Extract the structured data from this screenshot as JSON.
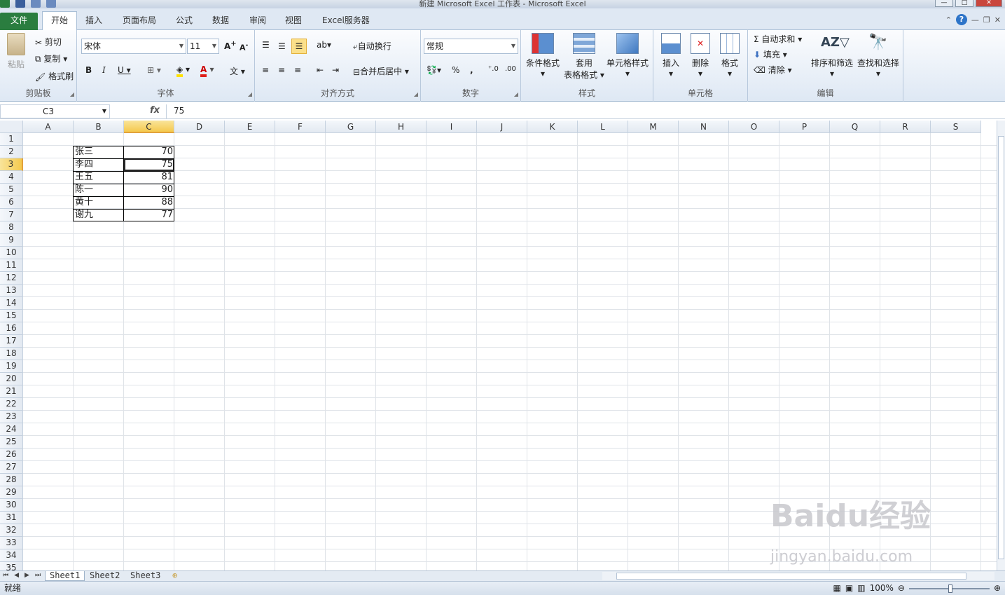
{
  "window": {
    "title": "新建 Microsoft Excel 工作表 - Microsoft Excel"
  },
  "tabs": {
    "file": "文件",
    "home": "开始",
    "insert": "插入",
    "layout": "页面布局",
    "formula": "公式",
    "data": "数据",
    "review": "审阅",
    "view": "视图",
    "server": "Excel服务器"
  },
  "clipboard": {
    "paste": "粘贴",
    "cut": "剪切",
    "copy": "复制",
    "format_painter": "格式刷",
    "label": "剪贴板"
  },
  "font": {
    "name": "宋体",
    "size": "11",
    "label": "字体"
  },
  "align": {
    "wrap": "自动换行",
    "merge": "合并后居中",
    "label": "对齐方式"
  },
  "number": {
    "format": "常规",
    "label": "数字"
  },
  "styles": {
    "cond": "条件格式",
    "table_1": "套用",
    "table_2": "表格格式",
    "cell": "单元格样式",
    "label": "样式"
  },
  "cells_grp": {
    "insert": "插入",
    "delete": "删除",
    "format": "格式",
    "label": "单元格"
  },
  "edit": {
    "autosum": "自动求和",
    "fill": "填充",
    "clear": "清除",
    "sort": "排序和筛选",
    "find": "查找和选择",
    "label": "编辑"
  },
  "formula_bar": {
    "name_box": "C3",
    "fx": "fx",
    "value": "75"
  },
  "columns": [
    "A",
    "B",
    "C",
    "D",
    "E",
    "F",
    "G",
    "H",
    "I",
    "J",
    "K",
    "L",
    "M",
    "N",
    "O",
    "P",
    "Q",
    "R",
    "S"
  ],
  "rows": [
    "1",
    "2",
    "3",
    "4",
    "5",
    "6",
    "7",
    "8",
    "9",
    "10",
    "11",
    "12",
    "13",
    "14",
    "15",
    "16",
    "17",
    "18",
    "19",
    "20",
    "21",
    "22",
    "23",
    "24",
    "25",
    "26",
    "27",
    "28",
    "29",
    "30",
    "31",
    "32",
    "33",
    "34",
    "35"
  ],
  "table": {
    "names": [
      "张三",
      "李四",
      "王五",
      "陈一",
      "黄十",
      "谢九"
    ],
    "scores": [
      "70",
      "75",
      "81",
      "90",
      "88",
      "77"
    ]
  },
  "sheets": [
    "Sheet1",
    "Sheet2",
    "Sheet3"
  ],
  "status": {
    "ready": "就绪",
    "zoom": "100%"
  },
  "watermark": {
    "brand": "Baidu经验",
    "url": "jingyan.baidu.com"
  }
}
